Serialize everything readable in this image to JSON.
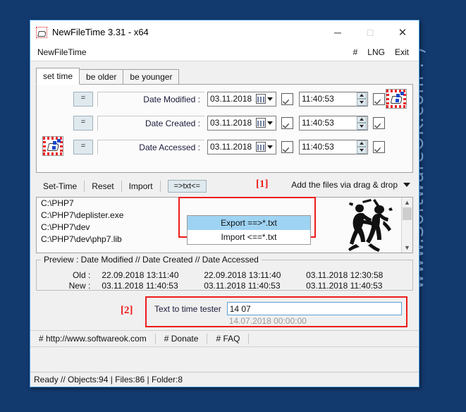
{
  "desktop": {
    "watermark": "www.SoftwareOK.com  :-)",
    "bg_color": "#133a6e"
  },
  "window": {
    "title": "NewFileTime 3.31 - x64",
    "icon": "app-icon",
    "caption": {
      "minimize": "─",
      "maximize": "□",
      "close": "✕"
    },
    "menubar": {
      "app_label": "NewFileTime",
      "hash": "#",
      "lng": "LNG",
      "exit": "Exit"
    }
  },
  "tabs": [
    {
      "label": "set time",
      "active": true
    },
    {
      "label": "be older",
      "active": false
    },
    {
      "label": "be younger",
      "active": false
    }
  ],
  "date_rows": [
    {
      "eq": "=",
      "label": "Date Modified :",
      "date": "03.11.2018",
      "date_checked": true,
      "time": "11:40:53",
      "time_checked": true
    },
    {
      "eq": "=",
      "label": "Date Created :",
      "date": "03.11.2018",
      "date_checked": true,
      "time": "11:40:53",
      "time_checked": true
    },
    {
      "eq": "=",
      "label": "Date Accessed :",
      "date": "03.11.2018",
      "date_checked": true,
      "time": "11:40:53",
      "time_checked": true
    }
  ],
  "toolbar": {
    "set_time": "Set-Time",
    "reset": "Reset",
    "import": "Import",
    "txt_button": "=>txt<=",
    "marker_1": "[1]",
    "drag_drop": "Add the files via drag & drop"
  },
  "dropdown": {
    "items": [
      {
        "label": "Export ==>*.txt",
        "selected": true
      },
      {
        "label": "Import <==*.txt",
        "selected": false
      }
    ]
  },
  "file_list": [
    "C:\\PHP7",
    "C:\\PHP7\\deplister.exe",
    "C:\\PHP7\\dev",
    "C:\\PHP7\\dev\\php7.lib"
  ],
  "preview": {
    "legend": "Preview :    Date Modified    //    Date Created    //    Date Accessed",
    "rows": [
      {
        "label": "Old :",
        "modified": "22.09.2018 13:11:40",
        "created": "22.09.2018 13:11:40",
        "accessed": "03.11.2018 12:30:58"
      },
      {
        "label": "New :",
        "modified": "03.11.2018 11:40:53",
        "created": "03.11.2018 11:40:53",
        "accessed": "03.11.2018 11:40:53"
      }
    ]
  },
  "tester": {
    "marker_2": "[2]",
    "label": "Text to time tester",
    "value": "14 07",
    "placeholder": "",
    "result": "14.07.2018 00:00:00"
  },
  "links": [
    "# http://www.softwareok.com",
    "# Donate",
    "# FAQ"
  ],
  "status": "Ready // Objects:94 | Files:86 | Folder:8",
  "colors": {
    "accent_red": "#ee1c1c",
    "highlight_blue": "#9ed3f3",
    "window_border": "#4ca0e0"
  }
}
